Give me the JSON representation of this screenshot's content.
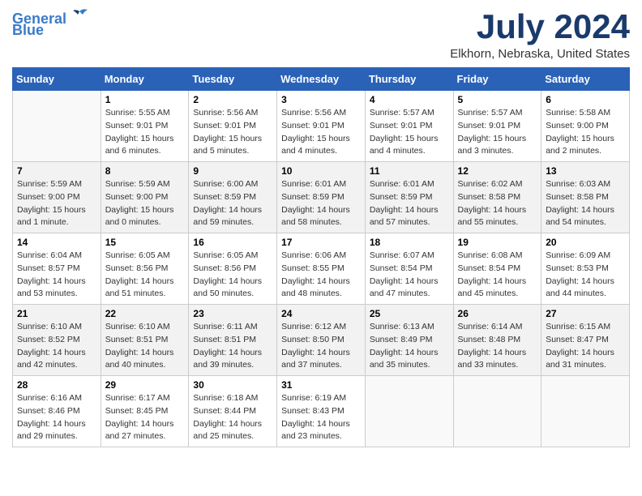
{
  "logo": {
    "line1": "General",
    "line2": "Blue"
  },
  "title": "July 2024",
  "location": "Elkhorn, Nebraska, United States",
  "days_header": [
    "Sunday",
    "Monday",
    "Tuesday",
    "Wednesday",
    "Thursday",
    "Friday",
    "Saturday"
  ],
  "weeks": [
    [
      {
        "num": "",
        "sunrise": "",
        "sunset": "",
        "daylight": ""
      },
      {
        "num": "1",
        "sunrise": "Sunrise: 5:55 AM",
        "sunset": "Sunset: 9:01 PM",
        "daylight": "Daylight: 15 hours and 6 minutes."
      },
      {
        "num": "2",
        "sunrise": "Sunrise: 5:56 AM",
        "sunset": "Sunset: 9:01 PM",
        "daylight": "Daylight: 15 hours and 5 minutes."
      },
      {
        "num": "3",
        "sunrise": "Sunrise: 5:56 AM",
        "sunset": "Sunset: 9:01 PM",
        "daylight": "Daylight: 15 hours and 4 minutes."
      },
      {
        "num": "4",
        "sunrise": "Sunrise: 5:57 AM",
        "sunset": "Sunset: 9:01 PM",
        "daylight": "Daylight: 15 hours and 4 minutes."
      },
      {
        "num": "5",
        "sunrise": "Sunrise: 5:57 AM",
        "sunset": "Sunset: 9:01 PM",
        "daylight": "Daylight: 15 hours and 3 minutes."
      },
      {
        "num": "6",
        "sunrise": "Sunrise: 5:58 AM",
        "sunset": "Sunset: 9:00 PM",
        "daylight": "Daylight: 15 hours and 2 minutes."
      }
    ],
    [
      {
        "num": "7",
        "sunrise": "Sunrise: 5:59 AM",
        "sunset": "Sunset: 9:00 PM",
        "daylight": "Daylight: 15 hours and 1 minute."
      },
      {
        "num": "8",
        "sunrise": "Sunrise: 5:59 AM",
        "sunset": "Sunset: 9:00 PM",
        "daylight": "Daylight: 15 hours and 0 minutes."
      },
      {
        "num": "9",
        "sunrise": "Sunrise: 6:00 AM",
        "sunset": "Sunset: 8:59 PM",
        "daylight": "Daylight: 14 hours and 59 minutes."
      },
      {
        "num": "10",
        "sunrise": "Sunrise: 6:01 AM",
        "sunset": "Sunset: 8:59 PM",
        "daylight": "Daylight: 14 hours and 58 minutes."
      },
      {
        "num": "11",
        "sunrise": "Sunrise: 6:01 AM",
        "sunset": "Sunset: 8:59 PM",
        "daylight": "Daylight: 14 hours and 57 minutes."
      },
      {
        "num": "12",
        "sunrise": "Sunrise: 6:02 AM",
        "sunset": "Sunset: 8:58 PM",
        "daylight": "Daylight: 14 hours and 55 minutes."
      },
      {
        "num": "13",
        "sunrise": "Sunrise: 6:03 AM",
        "sunset": "Sunset: 8:58 PM",
        "daylight": "Daylight: 14 hours and 54 minutes."
      }
    ],
    [
      {
        "num": "14",
        "sunrise": "Sunrise: 6:04 AM",
        "sunset": "Sunset: 8:57 PM",
        "daylight": "Daylight: 14 hours and 53 minutes."
      },
      {
        "num": "15",
        "sunrise": "Sunrise: 6:05 AM",
        "sunset": "Sunset: 8:56 PM",
        "daylight": "Daylight: 14 hours and 51 minutes."
      },
      {
        "num": "16",
        "sunrise": "Sunrise: 6:05 AM",
        "sunset": "Sunset: 8:56 PM",
        "daylight": "Daylight: 14 hours and 50 minutes."
      },
      {
        "num": "17",
        "sunrise": "Sunrise: 6:06 AM",
        "sunset": "Sunset: 8:55 PM",
        "daylight": "Daylight: 14 hours and 48 minutes."
      },
      {
        "num": "18",
        "sunrise": "Sunrise: 6:07 AM",
        "sunset": "Sunset: 8:54 PM",
        "daylight": "Daylight: 14 hours and 47 minutes."
      },
      {
        "num": "19",
        "sunrise": "Sunrise: 6:08 AM",
        "sunset": "Sunset: 8:54 PM",
        "daylight": "Daylight: 14 hours and 45 minutes."
      },
      {
        "num": "20",
        "sunrise": "Sunrise: 6:09 AM",
        "sunset": "Sunset: 8:53 PM",
        "daylight": "Daylight: 14 hours and 44 minutes."
      }
    ],
    [
      {
        "num": "21",
        "sunrise": "Sunrise: 6:10 AM",
        "sunset": "Sunset: 8:52 PM",
        "daylight": "Daylight: 14 hours and 42 minutes."
      },
      {
        "num": "22",
        "sunrise": "Sunrise: 6:10 AM",
        "sunset": "Sunset: 8:51 PM",
        "daylight": "Daylight: 14 hours and 40 minutes."
      },
      {
        "num": "23",
        "sunrise": "Sunrise: 6:11 AM",
        "sunset": "Sunset: 8:51 PM",
        "daylight": "Daylight: 14 hours and 39 minutes."
      },
      {
        "num": "24",
        "sunrise": "Sunrise: 6:12 AM",
        "sunset": "Sunset: 8:50 PM",
        "daylight": "Daylight: 14 hours and 37 minutes."
      },
      {
        "num": "25",
        "sunrise": "Sunrise: 6:13 AM",
        "sunset": "Sunset: 8:49 PM",
        "daylight": "Daylight: 14 hours and 35 minutes."
      },
      {
        "num": "26",
        "sunrise": "Sunrise: 6:14 AM",
        "sunset": "Sunset: 8:48 PM",
        "daylight": "Daylight: 14 hours and 33 minutes."
      },
      {
        "num": "27",
        "sunrise": "Sunrise: 6:15 AM",
        "sunset": "Sunset: 8:47 PM",
        "daylight": "Daylight: 14 hours and 31 minutes."
      }
    ],
    [
      {
        "num": "28",
        "sunrise": "Sunrise: 6:16 AM",
        "sunset": "Sunset: 8:46 PM",
        "daylight": "Daylight: 14 hours and 29 minutes."
      },
      {
        "num": "29",
        "sunrise": "Sunrise: 6:17 AM",
        "sunset": "Sunset: 8:45 PM",
        "daylight": "Daylight: 14 hours and 27 minutes."
      },
      {
        "num": "30",
        "sunrise": "Sunrise: 6:18 AM",
        "sunset": "Sunset: 8:44 PM",
        "daylight": "Daylight: 14 hours and 25 minutes."
      },
      {
        "num": "31",
        "sunrise": "Sunrise: 6:19 AM",
        "sunset": "Sunset: 8:43 PM",
        "daylight": "Daylight: 14 hours and 23 minutes."
      },
      {
        "num": "",
        "sunrise": "",
        "sunset": "",
        "daylight": ""
      },
      {
        "num": "",
        "sunrise": "",
        "sunset": "",
        "daylight": ""
      },
      {
        "num": "",
        "sunrise": "",
        "sunset": "",
        "daylight": ""
      }
    ]
  ]
}
